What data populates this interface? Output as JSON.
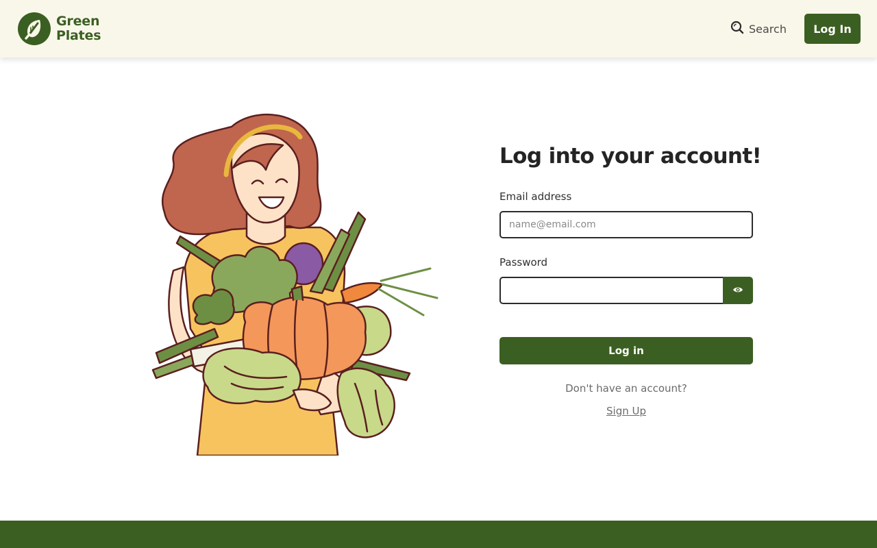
{
  "brand": {
    "name_line1": "Green",
    "name_line2": "Plates",
    "logo_icon": "leaf-fork-icon",
    "primary_color": "#3b5f22",
    "header_bg": "#f9f7ea"
  },
  "header": {
    "search_label": "Search",
    "search_icon": "search-icon",
    "login_label": "Log In"
  },
  "illustration": {
    "icon": "woman-holding-vegetables-illustration"
  },
  "form": {
    "title": "Log into your account!",
    "email_label": "Email address",
    "email_placeholder": "name@email.com",
    "email_value": "",
    "password_label": "Password",
    "password_value": "",
    "password_toggle_icon": "eye-icon",
    "submit_label": "Log in",
    "no_account_text": "Don't have an account?",
    "signup_label": "Sign Up"
  }
}
